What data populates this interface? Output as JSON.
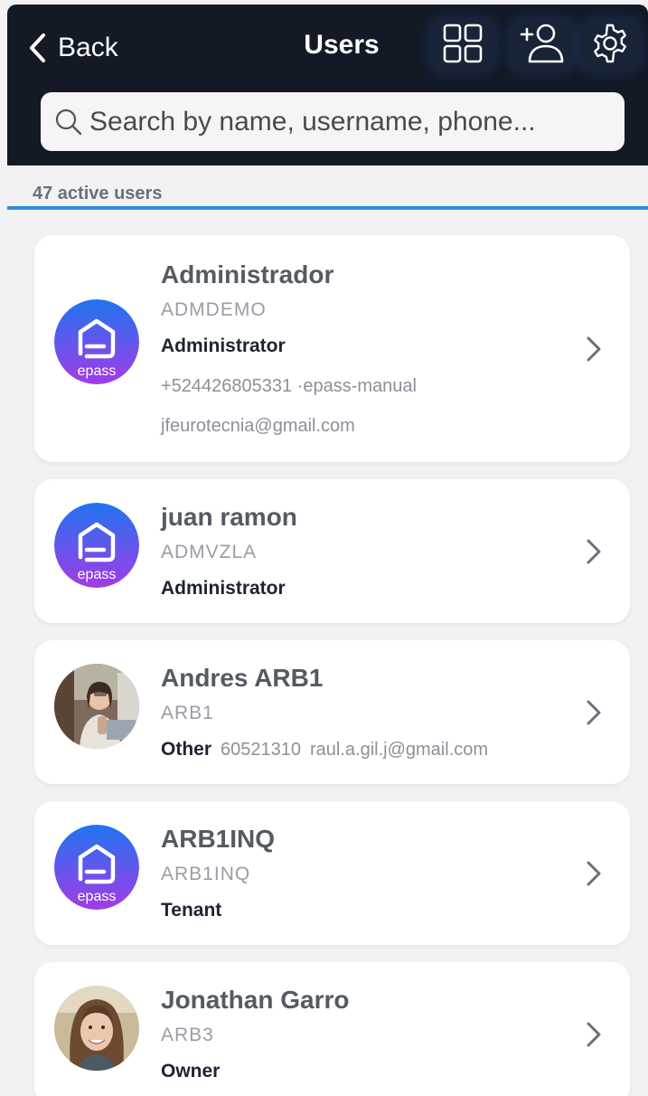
{
  "header": {
    "back_label": "Back",
    "title": "Users",
    "icons": [
      "chevron-left-icon",
      "grid-view-icon",
      "add-user-icon",
      "gear-icon"
    ]
  },
  "search": {
    "placeholder": "Search by name, username, phone...",
    "value": ""
  },
  "summary": {
    "count_text": "47 active users"
  },
  "colors": {
    "header_bg": "#131a26",
    "accent_line": "#2f8de4",
    "epass_gradient_top": "#1f74f0",
    "epass_gradient_bottom": "#a23be6"
  },
  "users": [
    {
      "name": "Administrador",
      "username": "ADMDEMO",
      "role": "Administrator",
      "phone_line": "+524426805331 ·epass-manual",
      "email": "jfeurotecnia@gmail.com",
      "avatar": "epass-logo"
    },
    {
      "name": "juan ramon",
      "username": "ADMVZLA",
      "role": "Administrator",
      "avatar": "epass-logo"
    },
    {
      "name": "Andres ARB1",
      "username": "ARB1",
      "role": "Other",
      "phone": "60521310",
      "email": "raul.a.gil.j@gmail.com",
      "avatar": "photo"
    },
    {
      "name": "ARB1INQ",
      "username": "ARB1INQ",
      "role": "Tenant",
      "avatar": "epass-logo"
    },
    {
      "name": "Jonathan Garro",
      "username": "ARB3",
      "role": "Owner",
      "avatar": "photo"
    }
  ],
  "epass_logo_text": "epass"
}
